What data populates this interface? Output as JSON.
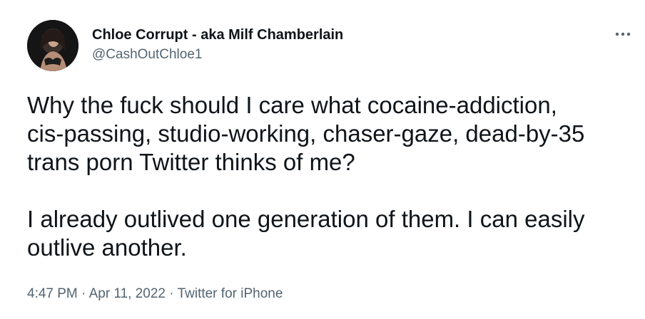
{
  "author": {
    "display_name": "Chloe Corrupt - aka Milf Chamberlain",
    "handle": "@CashOutChloe1"
  },
  "tweet": {
    "paragraph_1": "Why the fuck should I care what cocaine-addiction,\ncis-passing, studio-working, chaser-gaze, dead-by-35\ntrans porn Twitter thinks of me?",
    "paragraph_2": "I already outlived one generation of them. I can easily\noutlive another."
  },
  "meta": {
    "time": "4:47 PM",
    "separator": " · ",
    "date": "Apr 11, 2022",
    "source": "Twitter for iPhone"
  },
  "icons": {
    "more": "more-horizontal-icon"
  }
}
